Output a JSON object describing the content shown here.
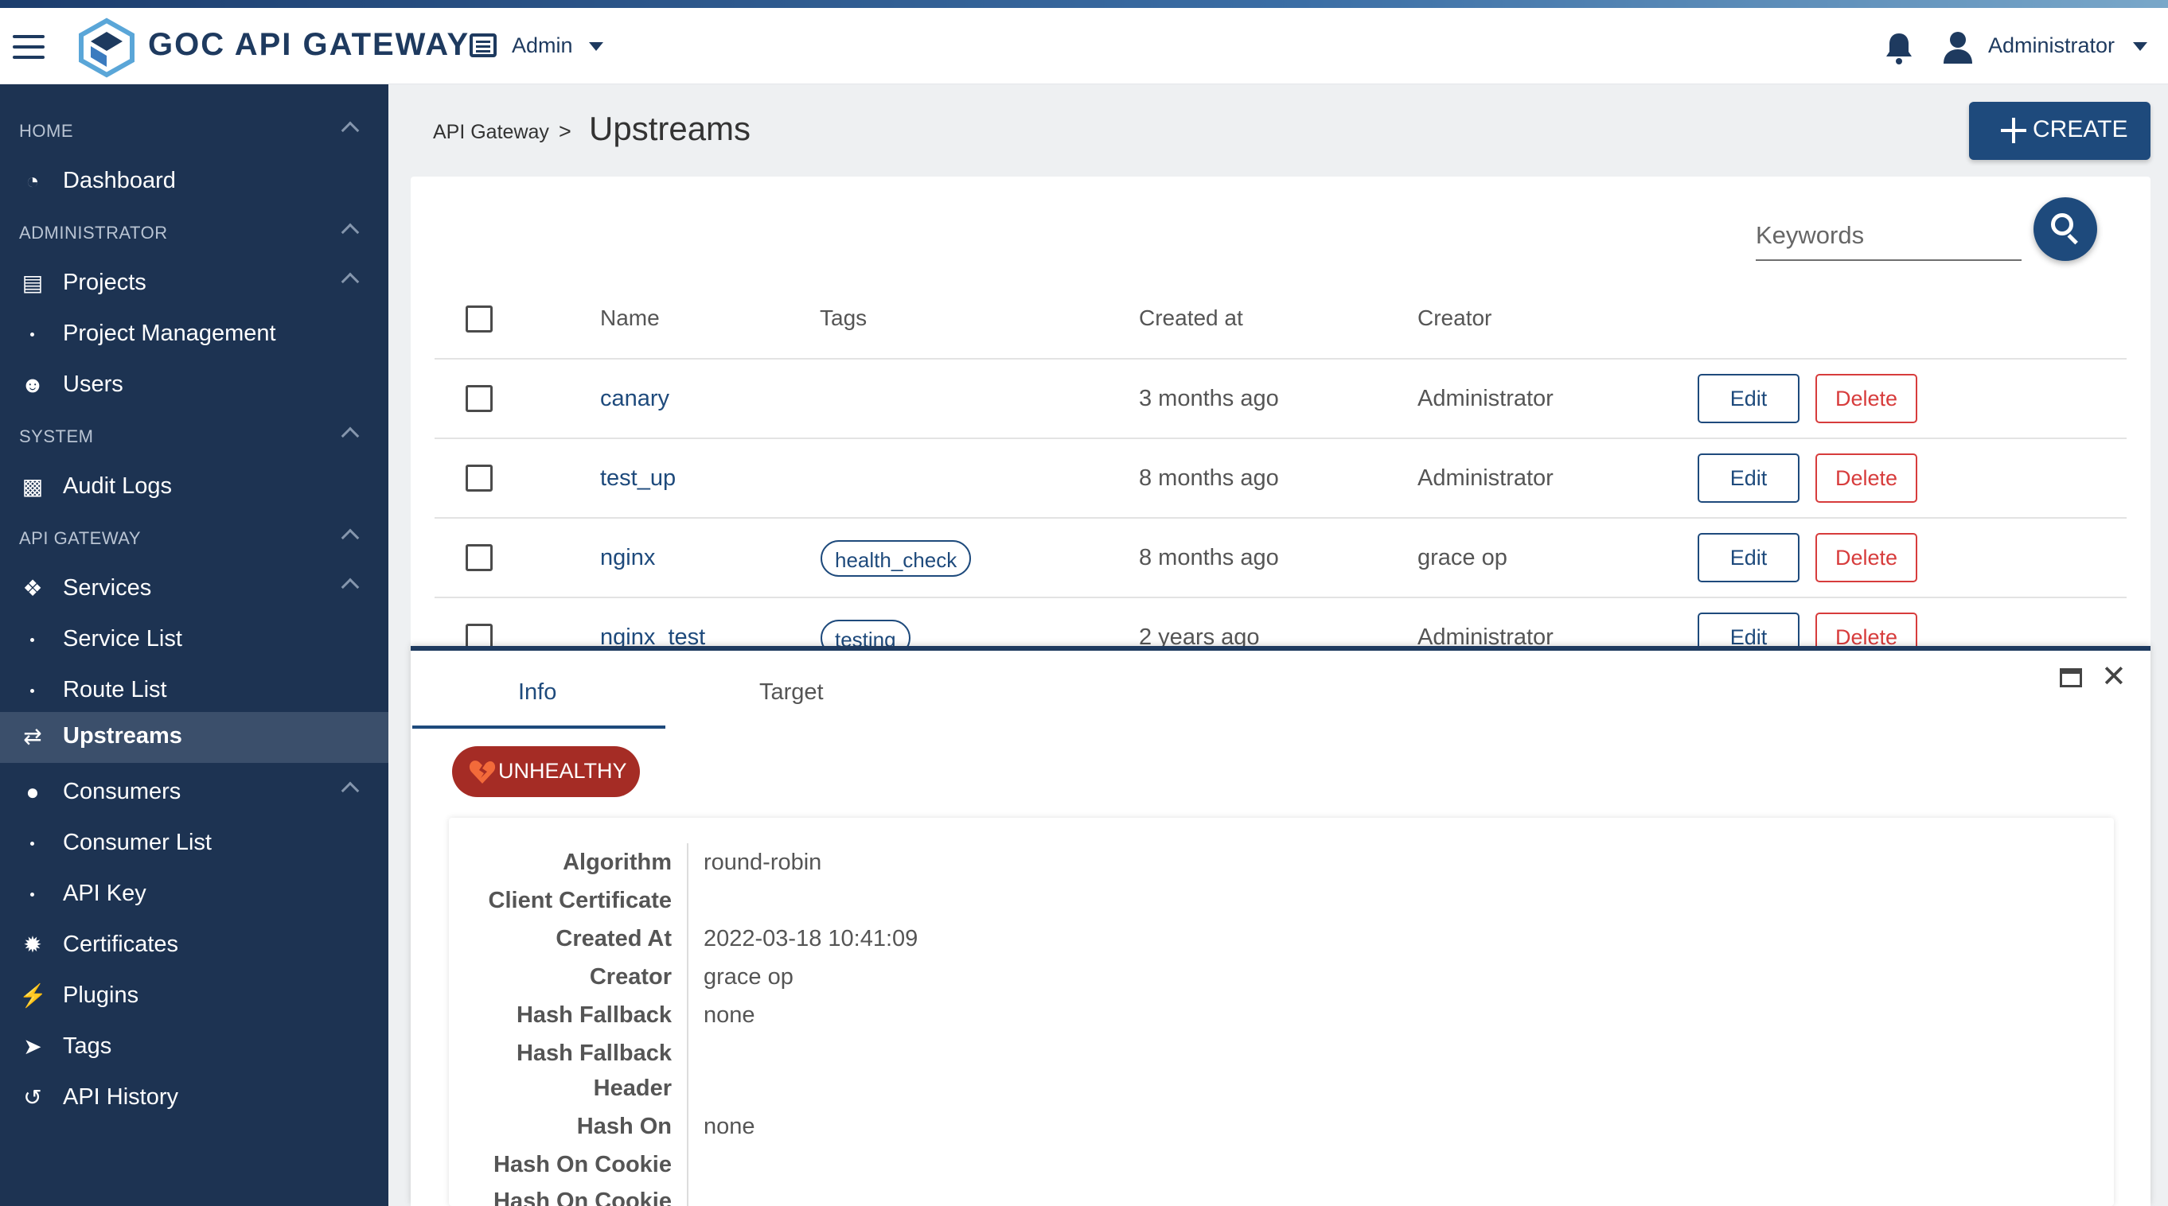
{
  "header": {
    "brand": "GOC API GATEWAY",
    "project_label": "Admin",
    "user_label": "Administrator"
  },
  "sidebar": {
    "sections": [
      "HOME",
      "ADMINISTRATOR",
      "SYSTEM",
      "API GATEWAY"
    ],
    "items": [
      {
        "label": "Dashboard",
        "icon": "dashboard-icon"
      },
      {
        "label": "Projects",
        "icon": "projects-icon"
      },
      {
        "label": "Project Management",
        "icon": "bullet"
      },
      {
        "label": "Users",
        "icon": "users-icon"
      },
      {
        "label": "Audit Logs",
        "icon": "file-icon"
      },
      {
        "label": "Services",
        "icon": "services-icon"
      },
      {
        "label": "Service List",
        "icon": "bullet"
      },
      {
        "label": "Route List",
        "icon": "bullet"
      },
      {
        "label": "Upstreams",
        "icon": "shuffle-icon",
        "active": true
      },
      {
        "label": "Consumers",
        "icon": "user-icon"
      },
      {
        "label": "Consumer List",
        "icon": "bullet"
      },
      {
        "label": "API Key",
        "icon": "bullet"
      },
      {
        "label": "Certificates",
        "icon": "certificate-icon"
      },
      {
        "label": "Plugins",
        "icon": "plug-icon"
      },
      {
        "label": "Tags",
        "icon": "tags-icon"
      },
      {
        "label": "API History",
        "icon": "history-icon"
      }
    ]
  },
  "page": {
    "breadcrumb": "API Gateway",
    "separator": ">",
    "title": "Upstreams",
    "create_label": "CREATE",
    "search_placeholder": "Keywords"
  },
  "table": {
    "headers": [
      "Name",
      "Tags",
      "Created at",
      "Creator"
    ],
    "rows": [
      {
        "name": "canary",
        "tag": "",
        "created": "3 months ago",
        "creator": "Administrator"
      },
      {
        "name": "test_up",
        "tag": "",
        "created": "8 months ago",
        "creator": "Administrator"
      },
      {
        "name": "nginx",
        "tag": "health_check",
        "created": "8 months ago",
        "creator": "grace op"
      },
      {
        "name": "nginx_test",
        "tag": "testing",
        "created": "2 years ago",
        "creator": "Administrator"
      }
    ],
    "edit_label": "Edit",
    "delete_label": "Delete"
  },
  "panel": {
    "tabs": [
      "Info",
      "Target"
    ],
    "status": "UNHEALTHY",
    "fields": [
      {
        "label": "Algorithm",
        "value": "round-robin"
      },
      {
        "label": "Client Certificate",
        "value": ""
      },
      {
        "label": "Created At",
        "value": "2022-03-18 10:41:09"
      },
      {
        "label": "Creator",
        "value": "grace op"
      },
      {
        "label": "Hash Fallback",
        "value": "none"
      },
      {
        "label": "Hash Fallback",
        "value": ""
      },
      {
        "label": "Header",
        "value": ""
      },
      {
        "label": "Hash On",
        "value": "none"
      },
      {
        "label": "Hash On Cookie",
        "value": ""
      },
      {
        "label": "Hash On Cookie",
        "value": ""
      }
    ]
  },
  "colors": {
    "sidebar_bg": "#1d3352",
    "primary": "#1e4a7c",
    "danger": "#d73c3c",
    "badge_unhealthy": "#a52c25"
  }
}
